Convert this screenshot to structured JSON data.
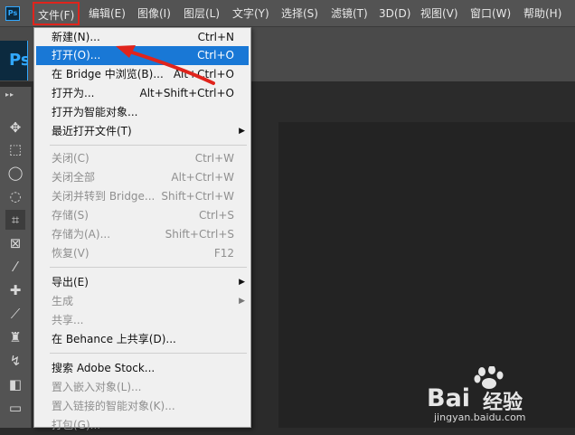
{
  "app": {
    "logo": "Ps",
    "big_logo": "Ps"
  },
  "menubar": [
    {
      "label": "文件(F)"
    },
    {
      "label": "编辑(E)"
    },
    {
      "label": "图像(I)"
    },
    {
      "label": "图层(L)"
    },
    {
      "label": "文字(Y)"
    },
    {
      "label": "选择(S)"
    },
    {
      "label": "滤镜(T)"
    },
    {
      "label": "3D(D)"
    },
    {
      "label": "视图(V)"
    },
    {
      "label": "窗口(W)"
    },
    {
      "label": "帮助(H)"
    }
  ],
  "file_menu": [
    {
      "label": "新建(N)...",
      "shortcut": "Ctrl+N"
    },
    {
      "label": "打开(O)...",
      "shortcut": "Ctrl+O",
      "highlighted": true
    },
    {
      "label": "在 Bridge 中浏览(B)...",
      "shortcut": "Alt+Ctrl+O"
    },
    {
      "label": "打开为...",
      "shortcut": "Alt+Shift+Ctrl+O"
    },
    {
      "label": "打开为智能对象...",
      "shortcut": ""
    },
    {
      "label": "最近打开文件(T)",
      "shortcut": "",
      "submenu": true
    },
    {
      "label": "关闭(C)",
      "shortcut": "Ctrl+W",
      "disabled": true
    },
    {
      "label": "关闭全部",
      "shortcut": "Alt+Ctrl+W",
      "disabled": true
    },
    {
      "label": "关闭并转到 Bridge...",
      "shortcut": "Shift+Ctrl+W",
      "disabled": true
    },
    {
      "label": "存储(S)",
      "shortcut": "Ctrl+S",
      "disabled": true
    },
    {
      "label": "存储为(A)...",
      "shortcut": "Shift+Ctrl+S",
      "disabled": true
    },
    {
      "label": "恢复(V)",
      "shortcut": "F12",
      "disabled": true
    },
    {
      "label": "导出(E)",
      "shortcut": "",
      "submenu": true
    },
    {
      "label": "生成",
      "shortcut": "",
      "submenu": true,
      "disabled": true
    },
    {
      "label": "共享...",
      "shortcut": "",
      "disabled": true
    },
    {
      "label": "在 Behance 上共享(D)...",
      "shortcut": ""
    },
    {
      "label": "搜索 Adobe Stock...",
      "shortcut": ""
    },
    {
      "label": "置入嵌入对象(L)...",
      "shortcut": "",
      "disabled": true
    },
    {
      "label": "置入链接的智能对象(K)...",
      "shortcut": "",
      "disabled": true
    },
    {
      "label": "打包(G)...",
      "shortcut": "",
      "disabled": true
    }
  ],
  "toolbar": {
    "collapse_glyph": "▸▸"
  },
  "watermark": {
    "logo": "Bai",
    "text": "经验",
    "url": "jingyan.baidu.com"
  },
  "colors": {
    "accent": "#1978d6",
    "annotation": "#e0241c",
    "ps_blue": "#31a8ff"
  }
}
